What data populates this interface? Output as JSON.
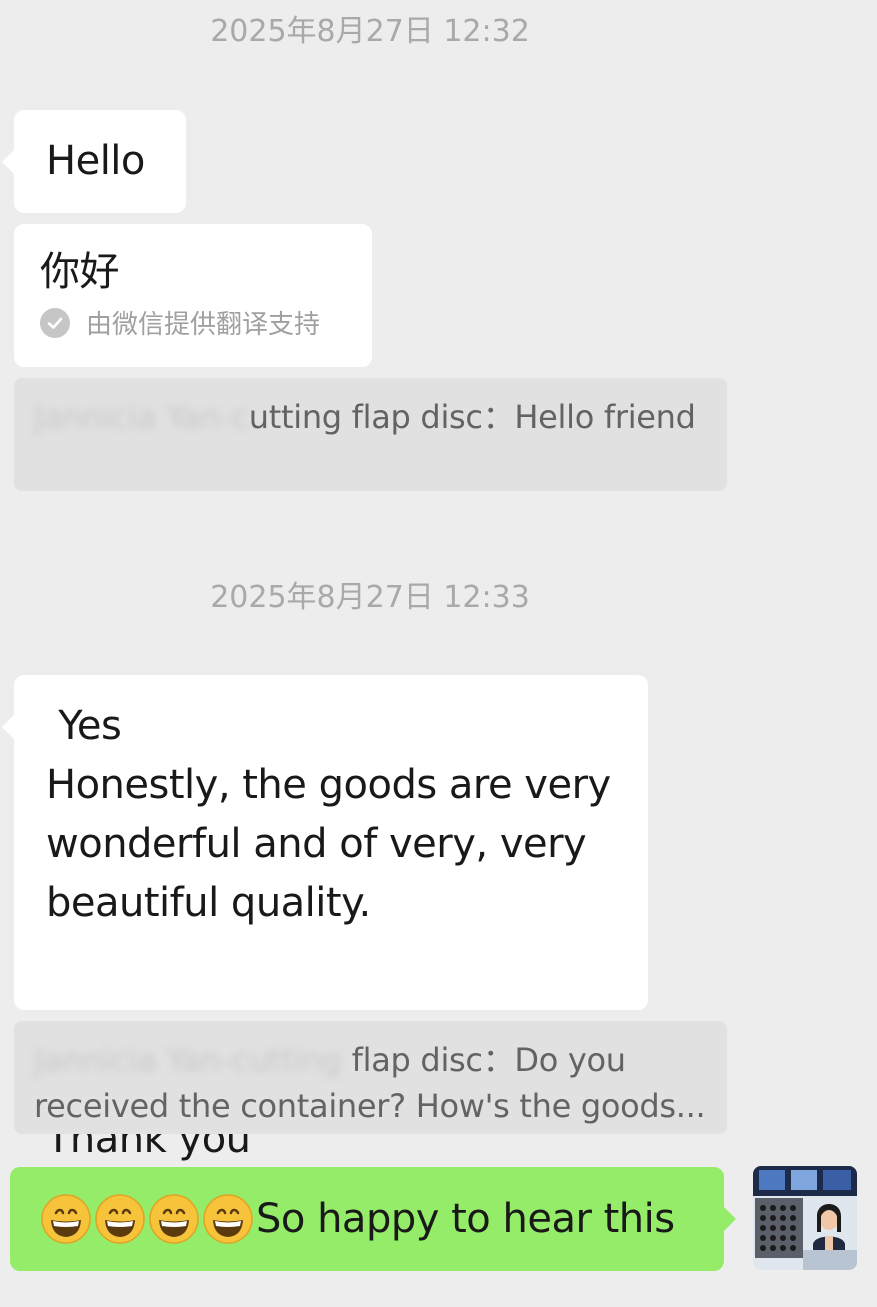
{
  "chat": {
    "timestamp_1": "2025年8月27日 12:32",
    "msg_hello": "Hello",
    "msg_nihao": "你好",
    "translate_note": "由微信提供翻译支持",
    "quote_1": {
      "sender": "Jannicia Yan-c",
      "sender_rest": "utting flap disc：Hello friend"
    },
    "timestamp_2": "2025年8月27日 12:33",
    "msg_long": " Yes\nHonestly, the goods are very\nwonderful and of very, very\nbeautiful quality.\nThank you",
    "quote_2": {
      "sender": "Jannicia Yan-cutting",
      "sender_rest": " flap disc：Do you received the container? How's the goods..."
    },
    "sent_msg": "So happy to hear this"
  },
  "icons": {
    "check": "check-icon",
    "rose": "rose-emoji",
    "grin": "grinning-emoji",
    "avatar": "avatar-photo"
  },
  "colors": {
    "background": "#ededed",
    "bubble_received": "#ffffff",
    "bubble_sent": "#95ec69",
    "quote_bg": "#e1e1e1",
    "timestamp": "#a9a9a9"
  }
}
